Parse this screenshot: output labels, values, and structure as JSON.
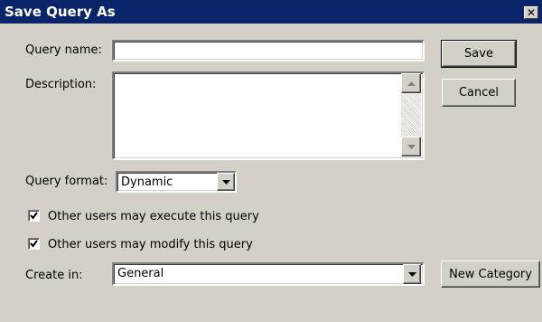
{
  "window": {
    "title": "Save Query As",
    "close_glyph": "✕"
  },
  "fields": {
    "query_name_label": "Query name:",
    "query_name_value": "",
    "description_label": "Description:",
    "description_value": "",
    "query_format_label": "Query format:",
    "query_format_value": "Dynamic",
    "create_in_label": "Create in:",
    "create_in_value": "General"
  },
  "checkboxes": {
    "execute": {
      "label": "Other users may execute this query",
      "checked": true
    },
    "modify": {
      "label": "Other users may modify this query",
      "checked": true
    }
  },
  "buttons": {
    "save": "Save",
    "cancel": "Cancel",
    "new_category": "New Category"
  },
  "icons": {
    "close": "close-icon",
    "scroll_up": "scroll-up-arrow-icon",
    "scroll_down": "scroll-down-arrow-icon",
    "dropdown": "dropdown-arrow-icon",
    "checkmark": "checkmark-icon"
  },
  "colors": {
    "title_bar": "#0a246a",
    "dialog_face": "#d4d0c8"
  }
}
